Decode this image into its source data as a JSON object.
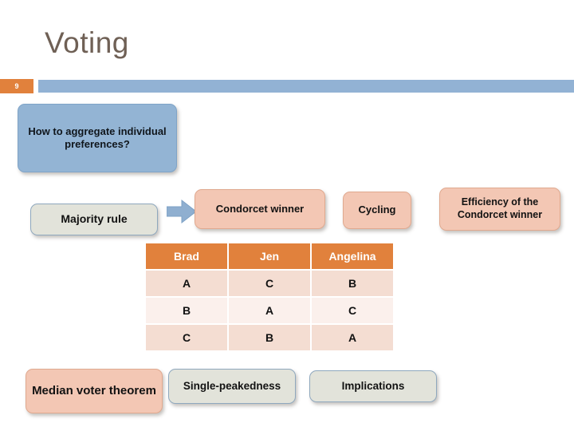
{
  "slide": {
    "title": "Voting",
    "number": "9",
    "accent_orange": "#e1813c",
    "accent_blue": "#92b2d4",
    "title_color": "#6f6055"
  },
  "nodes": {
    "question": "How to aggregate individual preferences?",
    "majority_rule": "Majority rule",
    "condorcet_winner": "Condorcet winner",
    "cycling": "Cycling",
    "efficiency": "Efficiency of the Condorcet winner",
    "median_voter": "Median voter theorem",
    "single_peakedness": "Single-peakedness",
    "implications": "Implications"
  },
  "arrow": {
    "name": "right-arrow-icon",
    "color": "#8fafd0"
  },
  "table": {
    "headers": [
      "Brad",
      "Jen",
      "Angelina"
    ],
    "rows": [
      [
        "A",
        "C",
        "B"
      ],
      [
        "B",
        "A",
        "C"
      ],
      [
        "C",
        "B",
        "A"
      ]
    ],
    "header_bg": "#e1813c",
    "band_dark": "#f4ddd2",
    "band_light": "#fbf0ec"
  }
}
